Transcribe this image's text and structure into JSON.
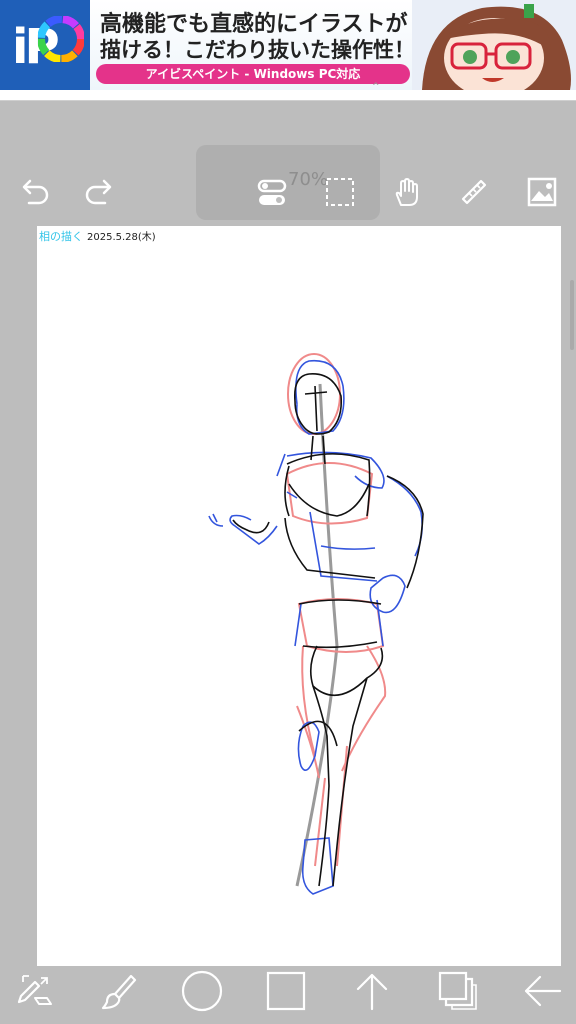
{
  "banner": {
    "logo_text": "iP",
    "headline": "高機能でも直感的にイラストが",
    "subline": "描ける！こだわり抜いた操作性！",
    "pill": "アイビスペイント - Windows PC対応"
  },
  "toolbar_top": {
    "zoom_text": "70%",
    "icons": [
      "undo-icon",
      "redo-icon",
      "layer-toggle-icon",
      "selection-icon",
      "hand-tool-icon",
      "ruler-icon",
      "reference-image-icon"
    ]
  },
  "canvas": {
    "note_label": "相の描く",
    "note_date": "2025.5.28(木)",
    "background": "#ffffff"
  },
  "toolbar_bottom": {
    "icons": [
      "tool-select-icon",
      "brush-icon",
      "color-circle-icon",
      "square-icon",
      "arrow-up-icon",
      "layers-icon",
      "back-arrow-icon"
    ]
  },
  "colors": {
    "background": "#bdbdbd",
    "icon": "#ffffff",
    "sketch_red": "#f08a8a",
    "sketch_blue": "#3355dd",
    "sketch_black": "#111111",
    "sketch_gray": "#9a9a9a",
    "pill": "#e4338a",
    "logo": "#1f5fb8"
  }
}
